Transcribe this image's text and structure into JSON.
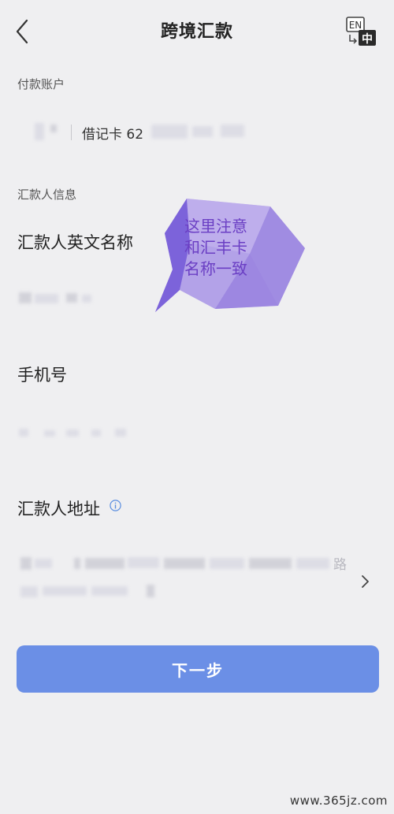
{
  "header": {
    "title": "跨境汇款",
    "lang_icon": {
      "top": "EN",
      "bottom": "中"
    }
  },
  "payment_account": {
    "section_label": "付款账户",
    "card_text": "借记卡 62"
  },
  "remitter": {
    "section_label": "汇款人信息",
    "english_name_label": "汇款人英文名称",
    "phone_label": "手机号",
    "address_label": "汇款人地址",
    "address_hint_icon": "info-icon",
    "address_value_end": "路"
  },
  "annotation": {
    "lines": [
      "这里注意",
      "和汇丰卡",
      "名称一致"
    ],
    "colors": {
      "fill_light": "#b3a2e8",
      "fill_dark": "#7c63da",
      "text": "#6b3fc4"
    }
  },
  "actions": {
    "next_label": "下一步"
  },
  "colors": {
    "background": "#efeff1",
    "primary_button": "#6b8fe6"
  },
  "watermark": "www.365jz.com"
}
